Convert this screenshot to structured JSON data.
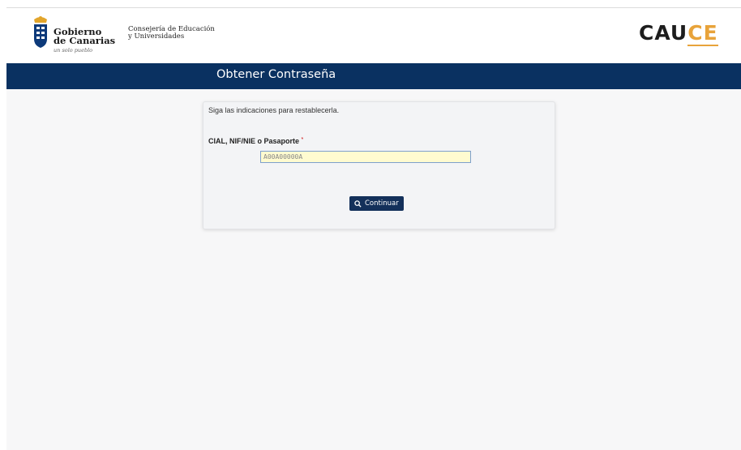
{
  "header": {
    "gob_line1": "Gobierno",
    "gob_line2": "de Canarias",
    "gob_sub": "un solo pueblo",
    "consejeria_line1": "Consejería de Educación",
    "consejeria_line2": "y Universidades",
    "cauce_prefix": "CAU",
    "cauce_suffix": "CE"
  },
  "title_bar": {
    "title": "Obtener Contraseña"
  },
  "form": {
    "instructions": "Siga las indicaciones para restablecerla.",
    "field_label": "CIAL, NIF/NIE o Pasaporte",
    "required_mark": "*",
    "field_placeholder": "A00A00000A",
    "field_value": "",
    "continue_label": "Continuar",
    "continue_icon": "search-icon"
  },
  "colors": {
    "bar": "#0a3161",
    "button": "#13305a",
    "cauce_accent": "#e8a33a",
    "input_bg": "#fffbd0"
  }
}
